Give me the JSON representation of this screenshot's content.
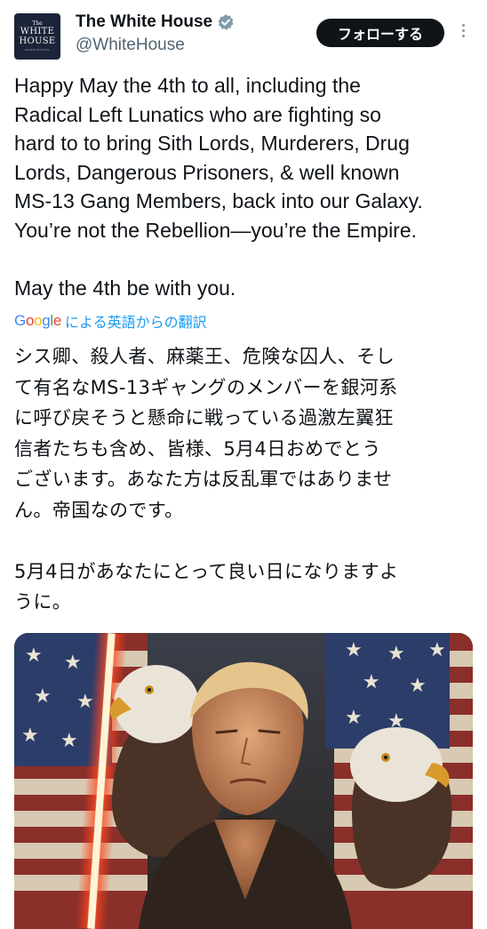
{
  "header": {
    "avatar_lines": [
      "The",
      "WHITE",
      "HOUSE",
      "WASHINGTON"
    ],
    "display_name": "The White House",
    "handle": "@WhiteHouse",
    "follow_label": "フォローする"
  },
  "tweet": {
    "lines": [
      "Happy May the 4th to all, including the",
      "Radical Left Lunatics who are fighting so",
      "hard to to bring Sith Lords, Murderers, Drug",
      "Lords, Dangerous Prisoners, & well known",
      "MS-13 Gang Members, back into our Galaxy.",
      "You’re not the Rebellion—you’re the Empire."
    ],
    "closing": "May the 4th be with you."
  },
  "translate": {
    "google": [
      "G",
      "o",
      "o",
      "g",
      "l",
      "e"
    ],
    "label": "による英語からの翻訳"
  },
  "translation": {
    "lines": [
      "シス卿、殺人者、麻薬王、危険な囚人、そし",
      "て有名なMS-13ギャングのメンバーを銀河系",
      "に呼び戻そうと懸命に戦っている過激左翼狂",
      "信者たちも含め、皆様、5月4日おめでとう",
      "ございます。あなた方は反乱軍ではありませ",
      "ん。帝国なのです。"
    ],
    "closing_lines": [
      "5月4日があなたにとって良い日になりますよ",
      "うに。"
    ]
  },
  "colors": {
    "accent": "#1d9bf0",
    "verified": "#829aab",
    "follow_bg": "#0f1419",
    "handle": "#536471"
  }
}
